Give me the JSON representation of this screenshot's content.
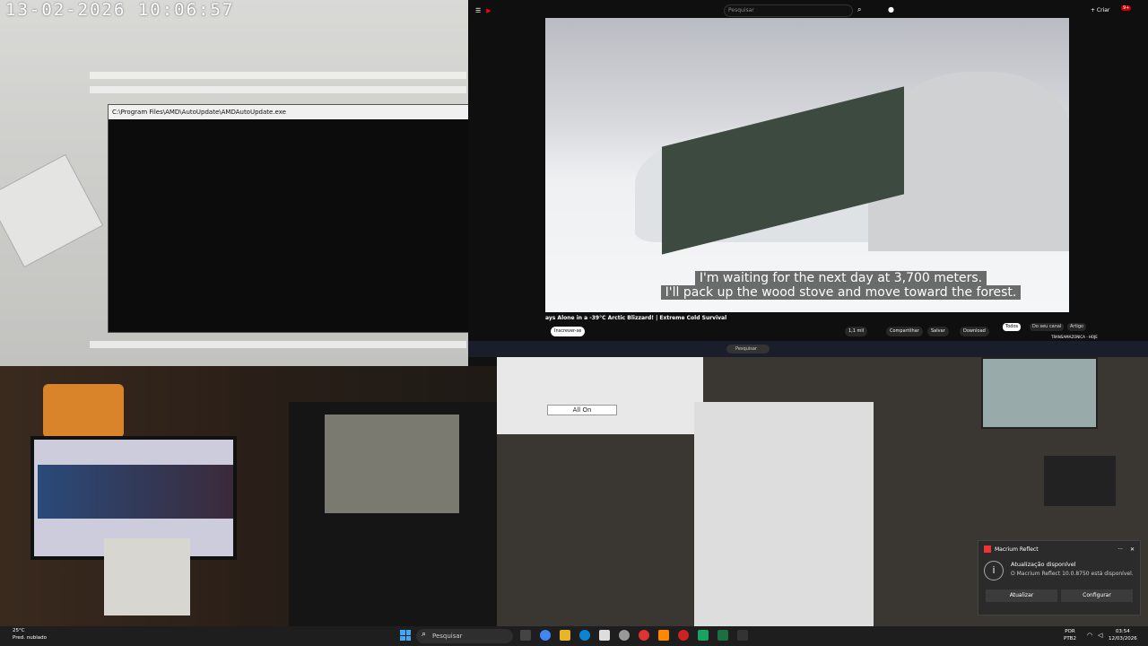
{
  "cam_tl": {
    "timestamp": "13-02-2026  10:06:57"
  },
  "console": {
    "title": "C:\\Program Files\\AMD\\AutoUpdate\\AMDAutoUpdate.exe",
    "min": "–",
    "max": "□",
    "close": "✕"
  },
  "youtube": {
    "search_placeholder": "Pesquisar",
    "create_label": "+ Criar",
    "notif_count": "9+",
    "subtitle_line1": "I'm waiting for the next day at 3,700 meters.",
    "subtitle_line2": "I'll pack up the wood stove and move toward the forest.",
    "video_title": "ays Alone in a -39°C Arctic Blizzard! | Extreme Cold Survival",
    "subscribe": "Inscrever-se",
    "likes": "1,1 mil",
    "share": "Compartilhar",
    "save": "Salvar",
    "download": "Download",
    "chip1": "Todos",
    "chip2": "Do seu canal",
    "chip3": "Artigo",
    "side_title": "TRANSAMAZONICA - HOJE"
  },
  "strip": {
    "search": "Pesquisar"
  },
  "cam_br": {
    "button": "All On"
  },
  "toast": {
    "app": "Macrium Reflect",
    "title": "Atualização disponível",
    "body": "O Macrium Reflect 10.0.8750 está disponível.",
    "btn_update": "Atualizar",
    "btn_config": "Configurar",
    "more": "···",
    "close": "✕"
  },
  "taskbar": {
    "temp": "25°C",
    "weather": "Pred. nublado",
    "search": "Pesquisar",
    "lang1": "POR",
    "lang2": "PTB2",
    "time": "03:54",
    "date": "12/03/2026"
  }
}
